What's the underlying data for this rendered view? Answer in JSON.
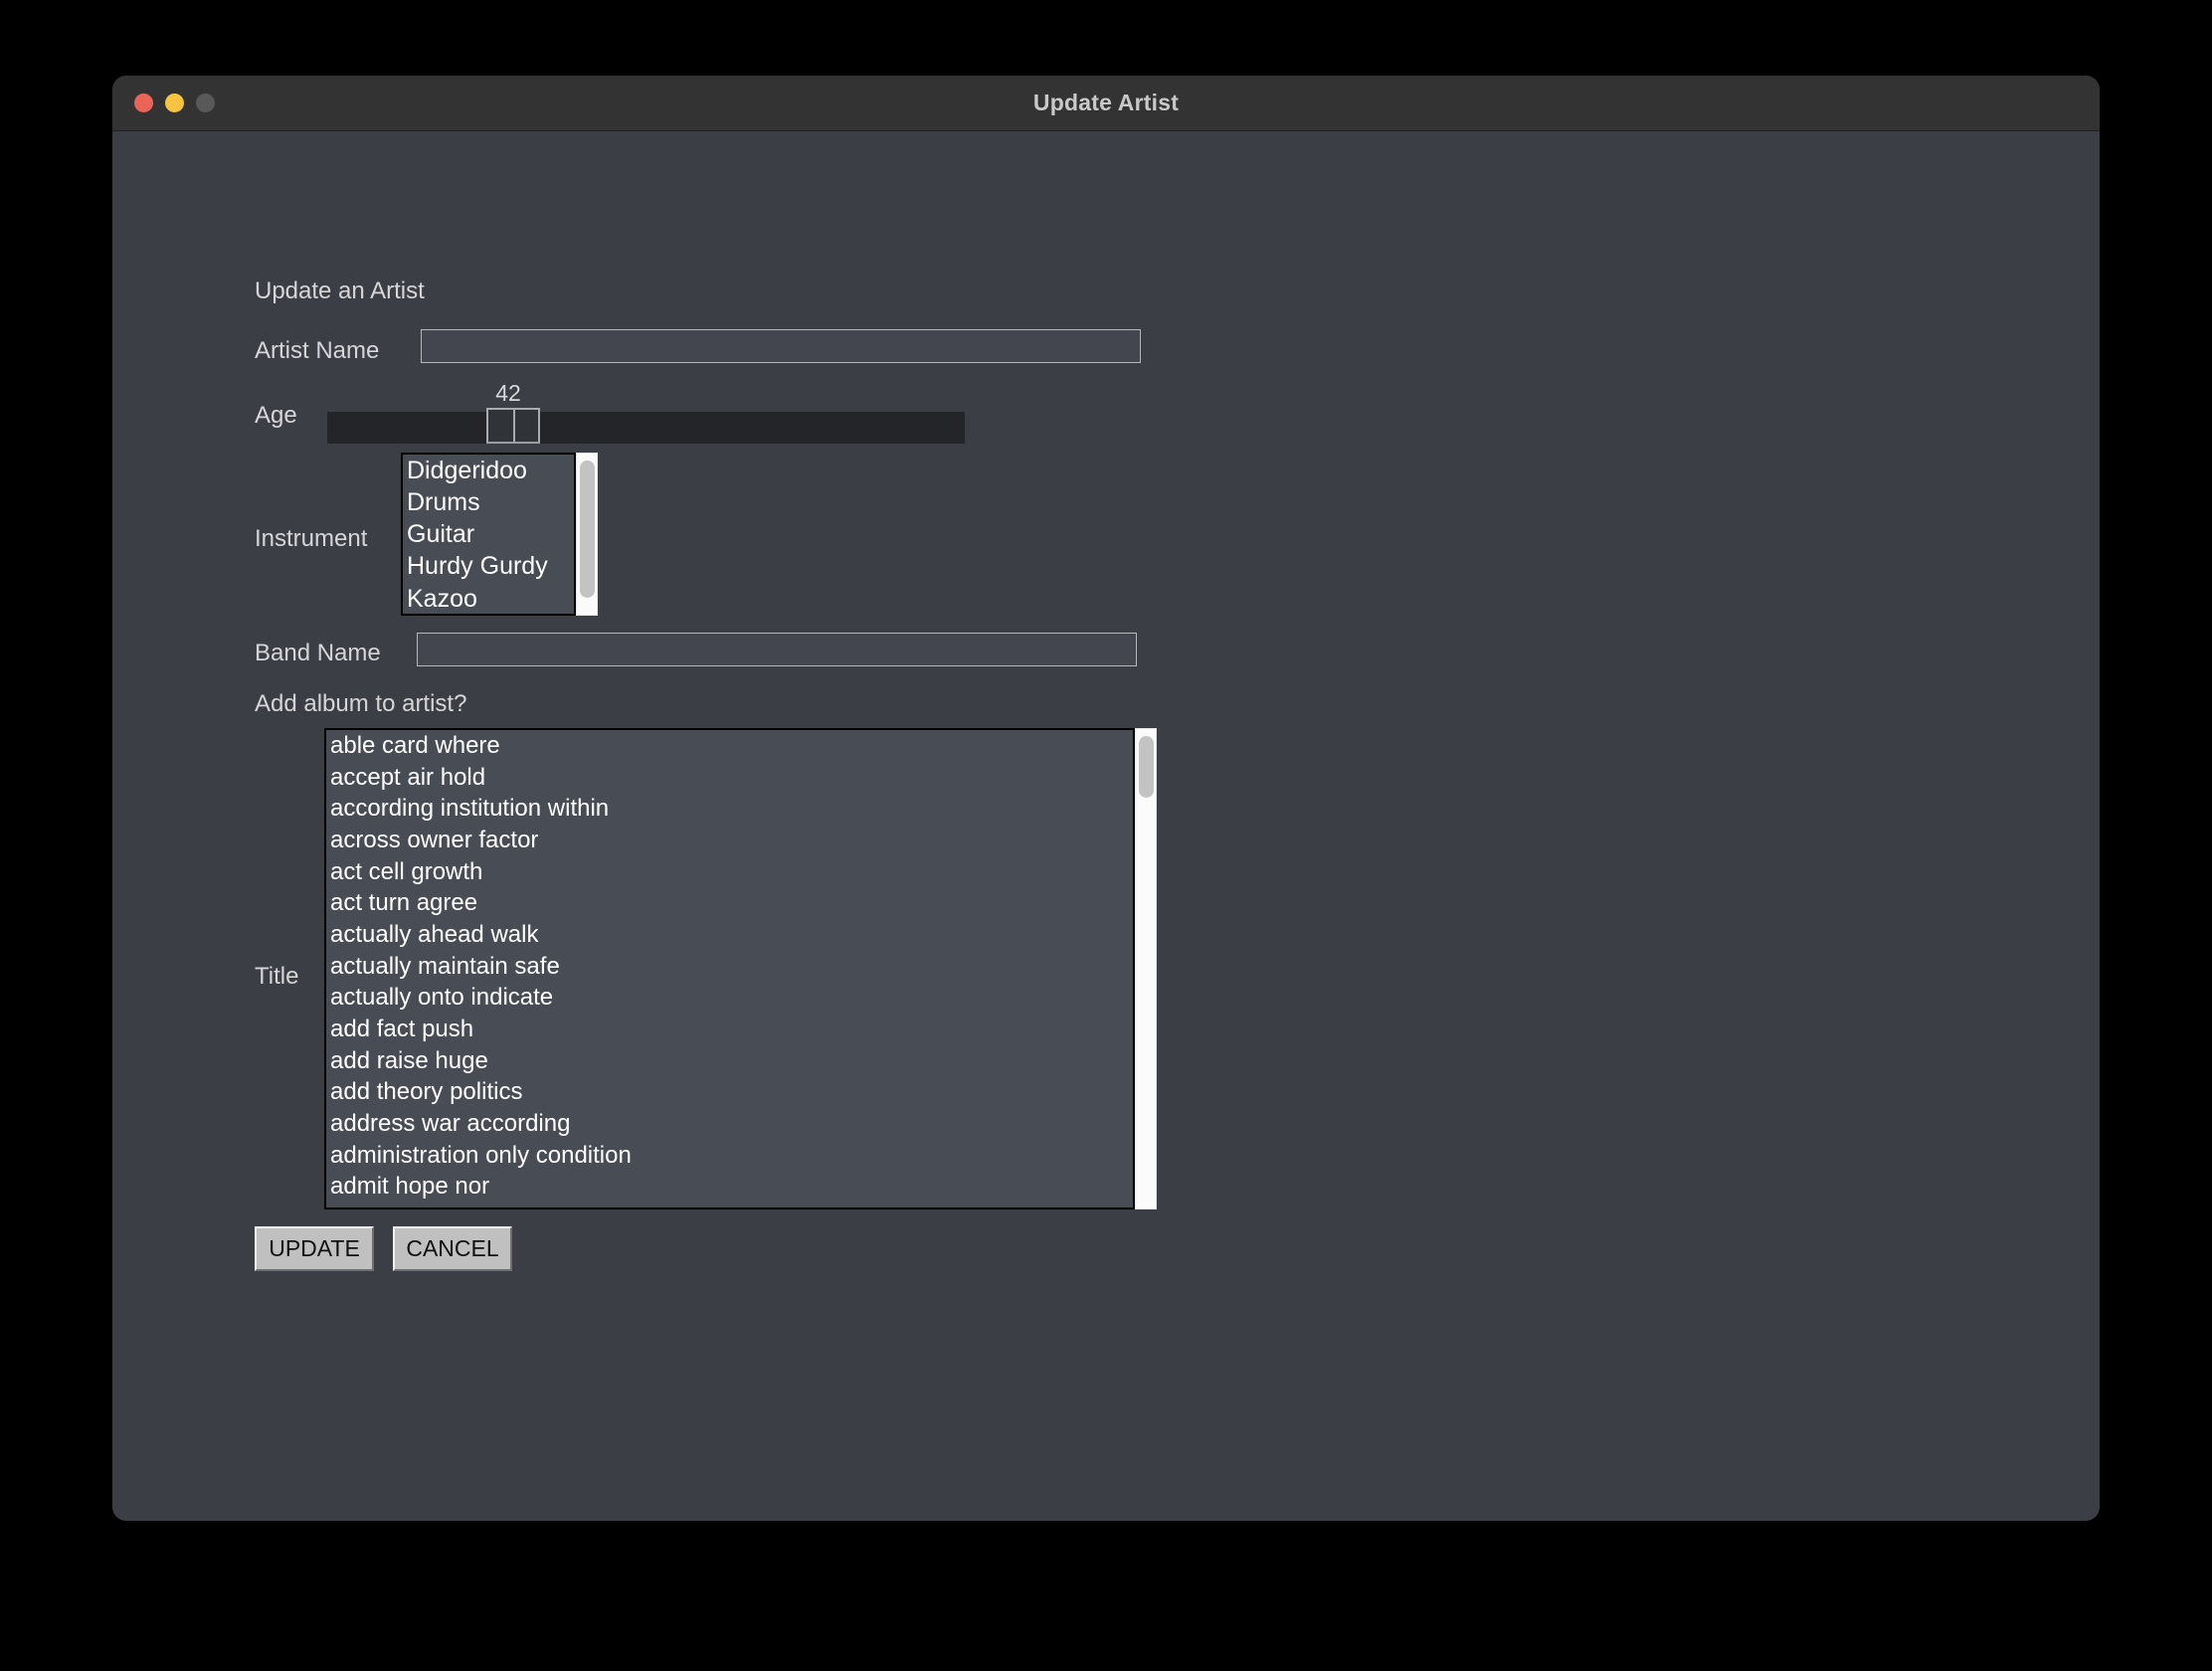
{
  "window": {
    "title": "Update Artist",
    "traffic_lights": [
      {
        "name": "close",
        "color": "#eb6459"
      },
      {
        "name": "minimize",
        "color": "#f7c340"
      },
      {
        "name": "zoom",
        "color": "#595959"
      }
    ]
  },
  "form": {
    "heading": "Update an Artist",
    "artist_name": {
      "label": "Artist Name",
      "value": "",
      "placeholder": ""
    },
    "age": {
      "label": "Age",
      "value": "42",
      "min": "0",
      "max": "100"
    },
    "instrument": {
      "label": "Instrument",
      "options": [
        "Didgeridoo",
        "Drums",
        "Guitar",
        "Hurdy Gurdy",
        "Kazoo"
      ]
    },
    "band_name": {
      "label": "Band Name",
      "value": "",
      "placeholder": ""
    },
    "add_album_question": "Add album to artist?",
    "title": {
      "label": "Title",
      "options": [
        "able card where",
        "accept air hold",
        "according institution within",
        "across owner factor",
        "act cell growth",
        "act turn agree",
        "actually ahead walk",
        "actually maintain safe",
        "actually onto indicate",
        "add fact push",
        "add raise huge",
        "add theory politics",
        "address war according",
        "administration only condition",
        "admit hope nor"
      ]
    }
  },
  "actions": {
    "update_label": "UPDATE",
    "cancel_label": "CANCEL"
  },
  "colors": {
    "window_bg": "#3b3e45",
    "titlebar_bg": "#333333",
    "desktop_bg": "#000000",
    "label_text": "#d6d6d6",
    "list_text": "#ffffff",
    "list_bg": "#484c55",
    "input_bg": "#43464e",
    "button_face": "#c0c0c0",
    "slider_track": "#232528"
  }
}
